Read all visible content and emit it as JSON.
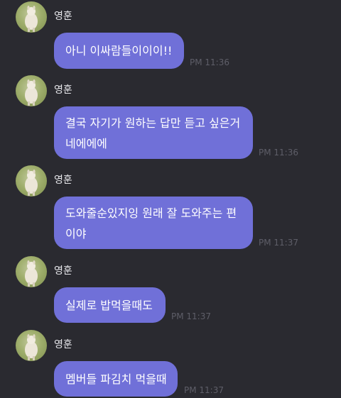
{
  "messages": [
    {
      "sender": "영훈",
      "lines": [
        "아니 이싸람들이이이!!"
      ],
      "time": "PM 11:36"
    },
    {
      "sender": "영훈",
      "lines": [
        "결국 자기가 원하는 답만 듣고 싶은거",
        "네에에에"
      ],
      "time": "PM 11:36"
    },
    {
      "sender": "영훈",
      "lines": [
        "도와줄순있지잉 원래 잘 도와주는 편",
        "이야"
      ],
      "time": "PM 11:37"
    },
    {
      "sender": "영훈",
      "lines": [
        "실제로 밥먹을때도"
      ],
      "time": "PM 11:37"
    },
    {
      "sender": "영훈",
      "lines": [
        "멤버들 파김치 먹을때"
      ],
      "time": "PM 11:37"
    }
  ],
  "colors": {
    "background": "#2a2a30",
    "bubble": "#7070d8",
    "bubble_text": "#ffffff",
    "sender_text": "#e6e6ea",
    "timestamp": "#5e5e68"
  },
  "icons": {
    "avatar": "alpaca-profile-photo"
  }
}
